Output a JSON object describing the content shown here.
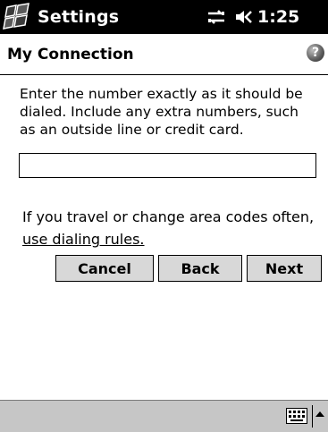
{
  "titlebar": {
    "app_title": "Settings",
    "clock": "1:25",
    "icons": [
      "start-menu-icon",
      "connectivity-icon",
      "volume-icon"
    ]
  },
  "header": {
    "title": "My Connection",
    "help_icon": "help-icon",
    "help_glyph": "?"
  },
  "content": {
    "instructions": "Enter the number exactly as it should be dialed.  Include any extra numbers, such as an outside line or credit card.",
    "number_value": "",
    "travel_text": "If you travel or change area codes often,",
    "rules_link": "use dialing rules."
  },
  "buttons": {
    "cancel": "Cancel",
    "back": "Back",
    "next": "Next"
  },
  "bottombar": {
    "icons": [
      "keyboard-icon",
      "sip-arrow-icon"
    ]
  }
}
